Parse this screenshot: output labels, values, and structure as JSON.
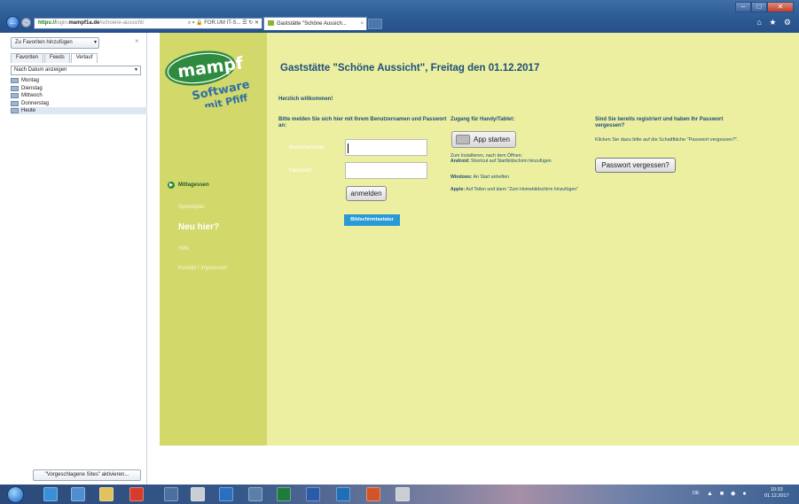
{
  "browser": {
    "address": {
      "protocol": "https://",
      "domain_sub": "login.",
      "domain": "mampf1a.de",
      "path": "/schoene-aussicht/",
      "tools": "⌕ ▾ 🔒 FOR.UM IT-S... ☰ ↻ ✕"
    },
    "tab": {
      "title": "Gaststätte \"Schöne Aussich...",
      "close": "×"
    },
    "window_buttons": [
      "–",
      "□",
      "✕"
    ],
    "toolbar_icons": "⌂ ★ ⚙",
    "nav_back": "←",
    "nav_forward": "→"
  },
  "favorites": {
    "add_label": "Zu Favoriten hinzufügen",
    "add_arrow": "▾",
    "close": "×",
    "tabs": [
      "Favoriten",
      "Feeds",
      "Verlauf"
    ],
    "sort_label": "Nach Datum anzeigen",
    "sort_arrow": "▼",
    "items": [
      "Montag",
      "Dienstag",
      "Mittwoch",
      "Donnerstag",
      "Heute"
    ],
    "suggested_label": "\"Vorgeschlagene Sites\" aktivieren..."
  },
  "site": {
    "logo": {
      "line1": "mampf",
      "line2": "Software",
      "line3": "mit Pfiff"
    },
    "menu": {
      "mittagessen": "Mittagessen",
      "speiseplan": "Speiseplan",
      "neu": "Neu hier?",
      "hilfe": "Hilfe",
      "kontakt": "Kontakt / Impressum"
    },
    "title": "Gaststätte \"Schöne Aussicht\", Freitag den 01.12.2017",
    "welcome": "Herzlich willkommen!",
    "login": {
      "heading": "Bitte melden Sie sich hier mit Ihrem Benutzernamen und Passwort an:",
      "user_label": "Benutzername:",
      "user_value": "",
      "pass_label": "Passwort:",
      "pass_value": "",
      "submit": "anmelden",
      "keyboard": "Bildschirmtastatur"
    },
    "app": {
      "heading": "Zugang für Handy/Tablet:",
      "button": "App starten",
      "install_intro": "Zum Installieren, nach dem Öffnen:",
      "android_label": "Android:",
      "android_text": " Shortcut auf Startbildschirm hinzufügen",
      "windows_label": "Windows:",
      "windows_text": " An Start anheften",
      "apple_label": "Apple:",
      "apple_text": " Auf Teilen und dann \"Zum Homebildschirm hinzufügen\""
    },
    "register": {
      "heading": "Sind Sie bereits registriert und haben Ihr Passwort vergessen?",
      "instruction": "Klicken Sie dazu bitte auf die Schaltfläche \"Passwort vergessen?\".",
      "button": "Passwort vergessen?"
    }
  },
  "taskbar": {
    "language": "DE",
    "tray": "▲ ■ ◆ ●",
    "time": "10:33",
    "date": "01.12.2017"
  },
  "colors": {
    "sidebar": "#d3d86a",
    "main": "#ecefa0",
    "title": "#1e4e7c",
    "keyboard_button": "#2a9ad6"
  }
}
